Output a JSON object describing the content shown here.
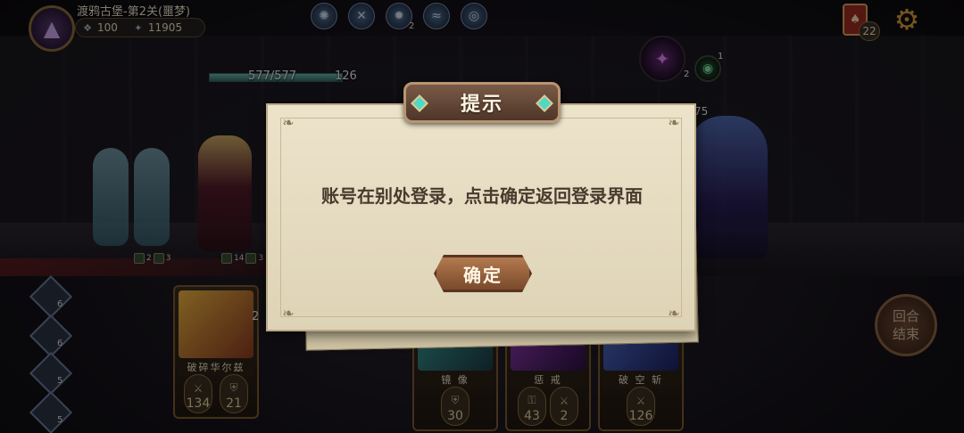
{
  "player": {
    "stage_title": "渡鸦古堡-第2关(噩梦)",
    "gems": "100",
    "gold": "11905"
  },
  "top_skills": {
    "count_badge": "2"
  },
  "top_right": {
    "deck_count": "22"
  },
  "hero": {
    "hp": "577/577",
    "energy": "126"
  },
  "enemy": {
    "orb_count": "2",
    "orb2_count": "1",
    "partial_hp": "75"
  },
  "ghost_badges": {
    "attack": "2",
    "shield": "3"
  },
  "hero_badges": {
    "attack": "14",
    "shield": "3"
  },
  "party": [
    {
      "count": "6"
    },
    {
      "count": "6"
    },
    {
      "count": "5"
    },
    {
      "count": "5"
    }
  ],
  "cards": [
    {
      "name": "破碎华尔兹",
      "stat1": "134",
      "stat2": "21",
      "cost": "2"
    },
    {
      "name": "镜 像",
      "stat1": "30"
    },
    {
      "name": "惩 戒",
      "stat1": "43",
      "stat2": "2"
    },
    {
      "name": "破 空 斩",
      "stat1": "126"
    }
  ],
  "end_turn": {
    "label_line1": "回合",
    "label_line2": "结束"
  },
  "dialog": {
    "title": "提示",
    "message": "账号在别处登录，点击确定返回登录界面",
    "confirm_label": "确定"
  },
  "colors": {
    "accent_gold": "#b89470",
    "dialog_bg": "#ece3cb",
    "button_brown": "#9a6440",
    "gem_teal": "#4ed8c8"
  }
}
